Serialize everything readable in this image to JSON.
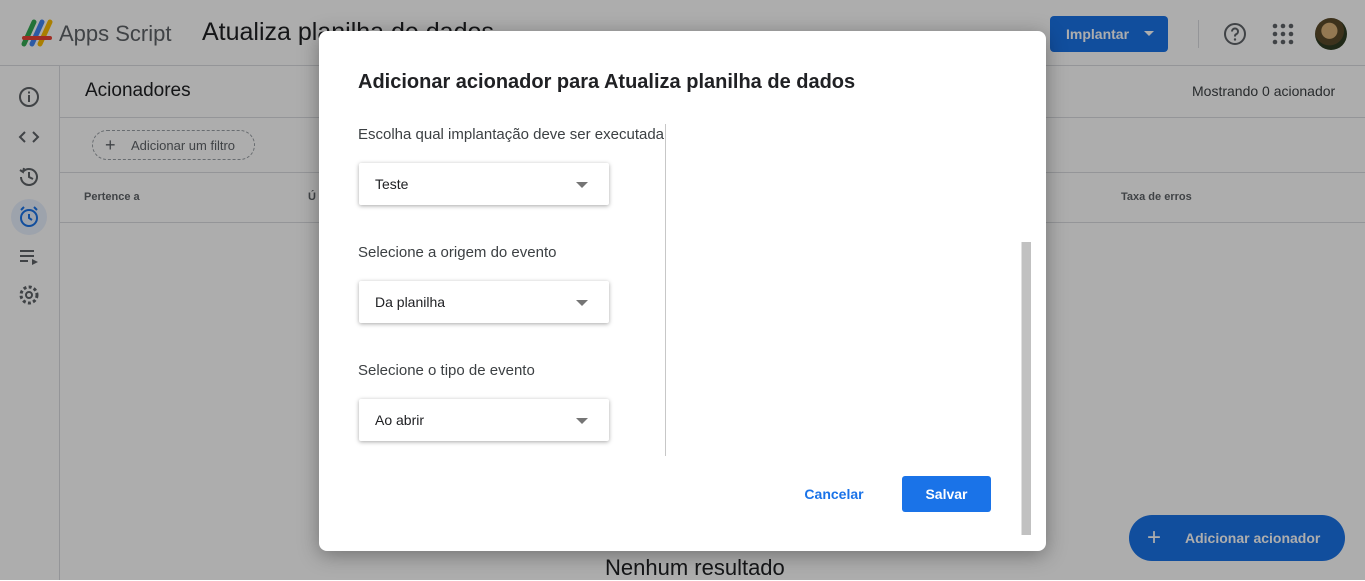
{
  "topbar": {
    "app_name": "Apps Script",
    "project_name": "Atualiza planilha de dados",
    "deploy_label": "Implantar"
  },
  "rail": {
    "items": [
      "info-icon",
      "code-icon",
      "history-icon",
      "alarm-icon",
      "executions-icon",
      "settings-icon"
    ],
    "active": "alarm-icon"
  },
  "page": {
    "title": "Acionadores",
    "showing": "Mostrando 0 acionador",
    "filter_label": "Adicionar um filtro",
    "columns": [
      "Pertence a",
      "Ú",
      "Taxa de erros"
    ],
    "empty": "Nenhum resultado",
    "fab_label": "Adicionar acionador"
  },
  "dialog": {
    "title": "Adicionar acionador para Atualiza planilha de dados",
    "fields": [
      {
        "label": "Escolha qual implantação deve ser executada",
        "value": "Teste"
      },
      {
        "label": "Selecione a origem do evento",
        "value": "Da planilha"
      },
      {
        "label": "Selecione o tipo de evento",
        "value": "Ao abrir"
      }
    ],
    "cancel_label": "Cancelar",
    "save_label": "Salvar"
  },
  "colors": {
    "accent": "#1a73e8",
    "scrim": "rgba(0,0,0,0.32)"
  }
}
